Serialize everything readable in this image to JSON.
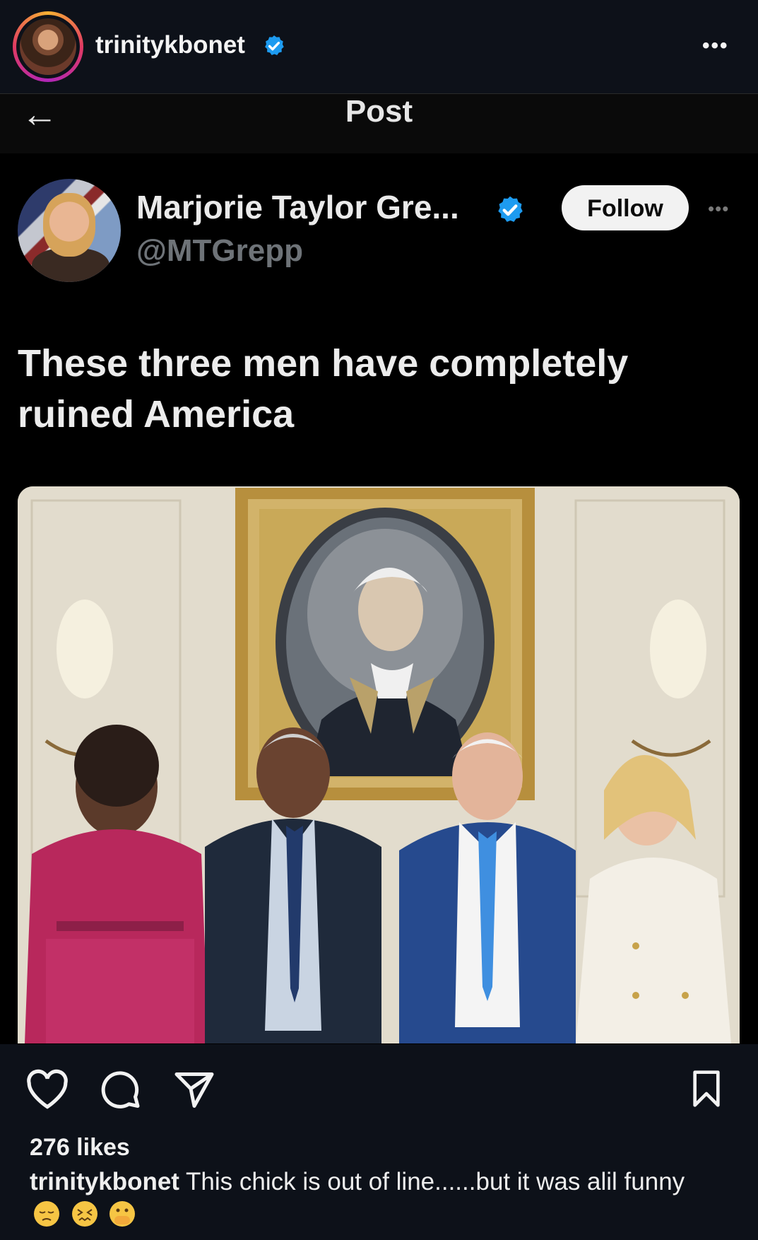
{
  "instagram": {
    "username": "trinitykbonet",
    "more_label": "•••",
    "likes": "276 likes",
    "caption_user": "trinitykbonet",
    "caption_text": "This chick is out of line......but it was alil funny"
  },
  "x_post": {
    "page_title": "Post",
    "back_label": "←",
    "author_name": "Marjorie Taylor Gre...",
    "author_handle": "@MTGrepp",
    "follow_label": "Follow",
    "more_label": "•••",
    "text": "These three men have completely ruined America"
  },
  "icons": [
    "verified-badge-icon",
    "back-arrow-icon",
    "heart-icon",
    "comment-icon",
    "share-icon",
    "bookmark-icon"
  ],
  "colors": {
    "verified": "#1d9bf0",
    "ring_start": "#f7b133",
    "ring_end": "#b026b9"
  }
}
